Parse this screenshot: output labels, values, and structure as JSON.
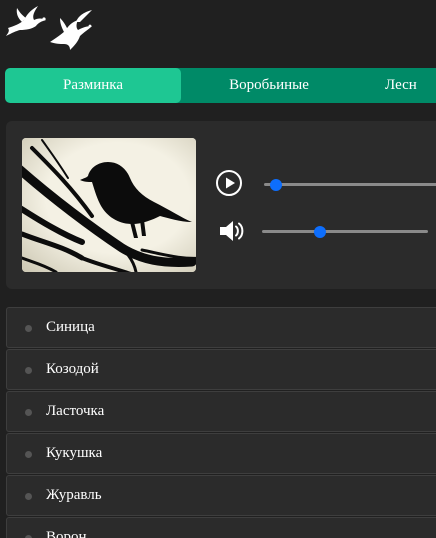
{
  "header": {
    "logo_icon": "two-birds-logo-icon"
  },
  "tabs": [
    {
      "label": "Разминка",
      "active": true
    },
    {
      "label": "Воробьиные",
      "active": false
    },
    {
      "label": "Лесн",
      "active": false
    }
  ],
  "player": {
    "image_icon": "bird-silhouette-on-branch",
    "play_icon": "play-circle-icon",
    "volume_icon": "speaker-volume-icon",
    "progress_fraction": 0.0,
    "volume_fraction": 0.35,
    "accent_color": "#0d6efd"
  },
  "birds": [
    {
      "name": "Синица"
    },
    {
      "name": "Козодой"
    },
    {
      "name": "Ласточка"
    },
    {
      "name": "Кукушка"
    },
    {
      "name": "Журавль"
    },
    {
      "name": "Ворон"
    }
  ],
  "colors": {
    "background": "#202020",
    "panel": "#2b2b2b",
    "tab_active": "#1ec793",
    "tab_bar": "#008a67"
  }
}
